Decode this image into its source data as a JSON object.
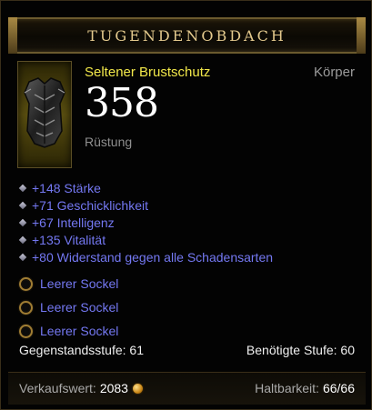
{
  "header": {
    "title": "TUGENDENOBDACH"
  },
  "item": {
    "name": "Seltener Brustschutz",
    "slot": "Körper",
    "armor_value": "358",
    "armor_label": "Rüstung",
    "icon": "chest-armor-icon"
  },
  "stats": [
    {
      "text": "+148 Stärke"
    },
    {
      "text": "+71 Geschicklichkeit"
    },
    {
      "text": "+67 Intelligenz"
    },
    {
      "text": "+135 Vitalität"
    },
    {
      "text": "+80 Widerstand gegen alle Schadensarten"
    }
  ],
  "sockets": [
    {
      "label": "Leerer Sockel"
    },
    {
      "label": "Leerer Sockel"
    },
    {
      "label": "Leerer Sockel"
    }
  ],
  "requirements": {
    "item_level": "Gegenstandsstufe: 61",
    "required_level": "Benötigte Stufe: 60"
  },
  "footer": {
    "sell_label": "Verkaufswert:",
    "sell_value": "2083",
    "durability_label": "Haltbarkeit:",
    "durability_value": "66/66"
  },
  "colors": {
    "rare_name": "#f2e84a",
    "magic_affix": "#7478f2",
    "header_gold": "#e3c98d",
    "border_gold": "#6b5a2e"
  }
}
